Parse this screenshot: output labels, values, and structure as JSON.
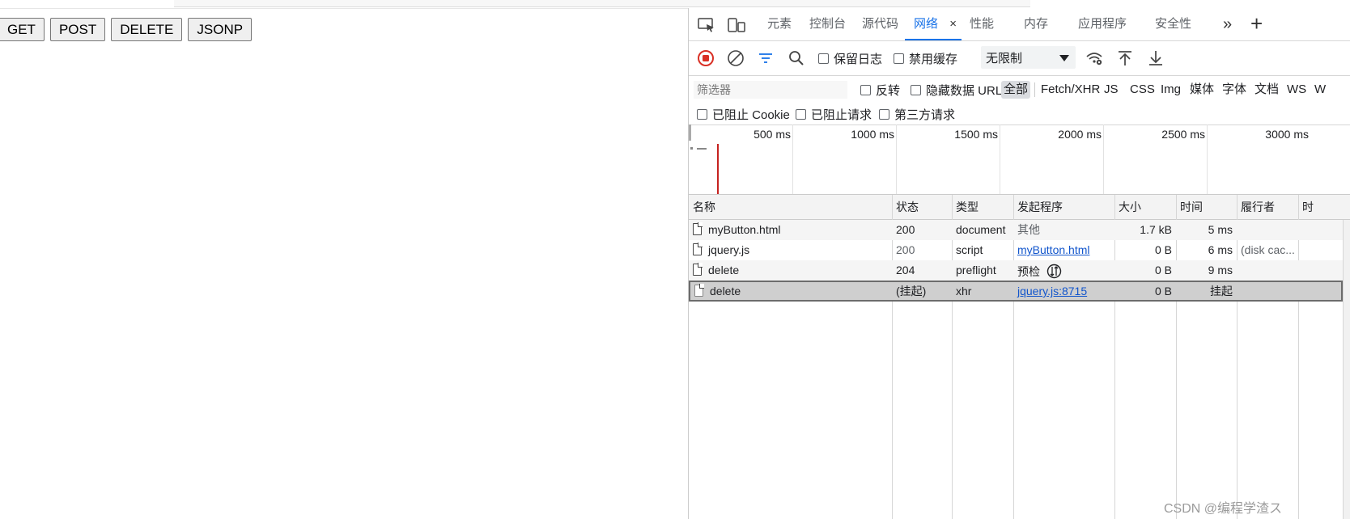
{
  "page": {
    "buttons": [
      "GET",
      "POST",
      "DELETE",
      "JSONP"
    ]
  },
  "devtools": {
    "tabs": [
      "元素",
      "控制台",
      "源代码",
      "网络",
      "性能",
      "内存",
      "应用程序",
      "安全性"
    ],
    "active_tab": "网络",
    "more_tabs": "»",
    "add_tab": "+",
    "close_tab": "×",
    "toolbar": {
      "preserve_log": "保留日志",
      "disable_cache": "禁用缓存",
      "throttle": "无限制"
    },
    "filter": {
      "placeholder": "筛选器",
      "invert": "反转",
      "hide_data_url": "隐藏数据 URL",
      "types": [
        "全部",
        "Fetch/XHR",
        "JS",
        "CSS",
        "Img",
        "媒体",
        "字体",
        "文档",
        "WS",
        "W"
      ],
      "selected_type": "全部",
      "blocked_cookies": "已阻止 Cookie",
      "blocked_requests": "已阻止请求",
      "third_party": "第三方请求"
    },
    "overview": {
      "ticks": [
        "500 ms",
        "1000 ms",
        "1500 ms",
        "2000 ms",
        "2500 ms",
        "3000 ms"
      ]
    },
    "table": {
      "headers": [
        "名称",
        "状态",
        "类型",
        "发起程序",
        "大小",
        "时间",
        "履行者",
        "时"
      ],
      "rows": [
        {
          "name": "myButton.html",
          "status": "200",
          "type": "document",
          "initiator": "其他",
          "size": "1.7 kB",
          "time": "5 ms",
          "fulfilled": ""
        },
        {
          "name": "jquery.js",
          "status": "200",
          "type": "script",
          "initiator": "myButton.html",
          "size": "0 B",
          "time": "6 ms",
          "fulfilled": "(disk cac..."
        },
        {
          "name": "delete",
          "status": "204",
          "type": "preflight",
          "initiator": "预检",
          "size": "0 B",
          "time": "9 ms",
          "fulfilled": ""
        },
        {
          "name": "delete",
          "status": "(挂起)",
          "type": "xhr",
          "initiator": "jquery.js:8715",
          "size": "0 B",
          "time": "挂起",
          "fulfilled": ""
        }
      ]
    }
  },
  "watermark": "CSDN @编程学渣ス",
  "colors": {
    "accent": "#1a73e8",
    "record": "#d93025",
    "link": "#1155cc"
  }
}
